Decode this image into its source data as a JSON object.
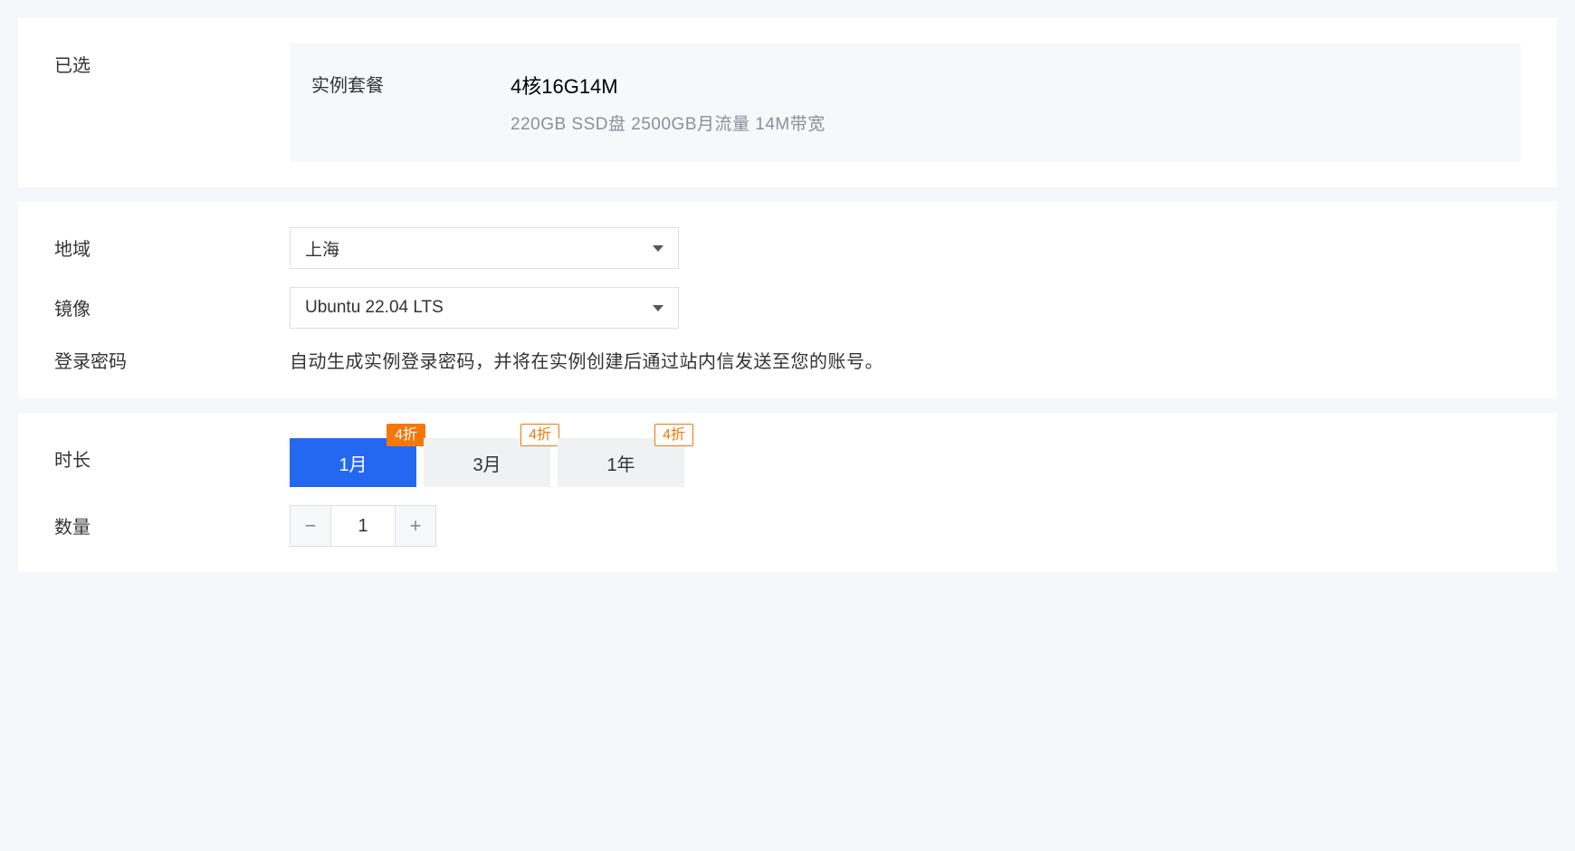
{
  "selected": {
    "label": "已选",
    "package_label": "实例套餐",
    "package_value": "4核16G14M",
    "package_detail": "220GB SSD盘 2500GB月流量 14M带宽"
  },
  "region": {
    "label": "地域",
    "value": "上海"
  },
  "image": {
    "label": "镜像",
    "value": "Ubuntu 22.04 LTS"
  },
  "password": {
    "label": "登录密码",
    "text": "自动生成实例登录密码，并将在实例创建后通过站内信发送至您的账号。"
  },
  "duration": {
    "label": "时长",
    "options": [
      {
        "text": "1月",
        "badge": "4折",
        "selected": true
      },
      {
        "text": "3月",
        "badge": "4折",
        "selected": false
      },
      {
        "text": "1年",
        "badge": "4折",
        "selected": false
      }
    ]
  },
  "quantity": {
    "label": "数量",
    "value": "1"
  }
}
